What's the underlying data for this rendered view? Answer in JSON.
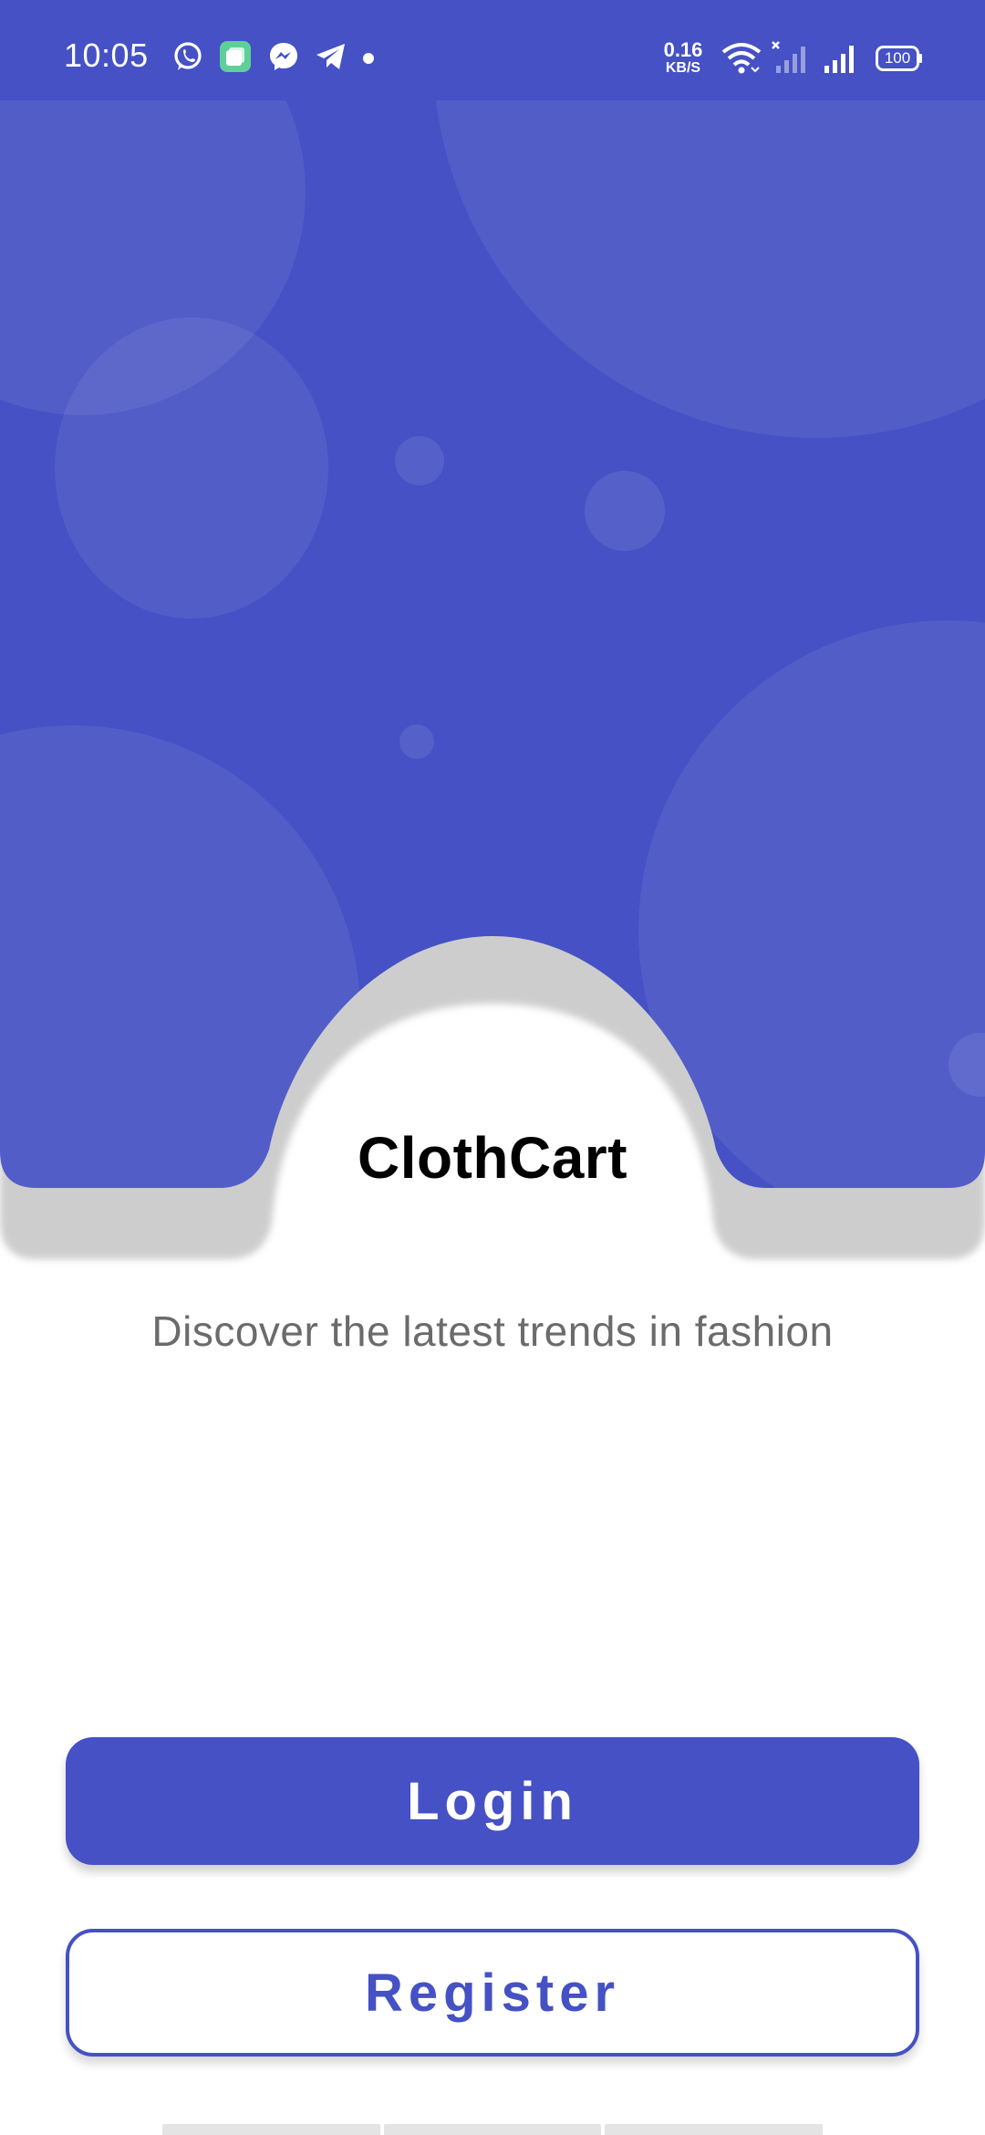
{
  "status_bar": {
    "time": "10:05",
    "net_speed_value": "0.16",
    "net_speed_unit": "KB/S",
    "battery": "100",
    "notification_icons": [
      "whatsapp-icon",
      "multitask-app-icon",
      "messenger-icon",
      "telegram-icon",
      "more-dot-icon"
    ],
    "system_icons": [
      "wifi-icon",
      "signal-no-sim-icon",
      "signal-icon",
      "battery-icon"
    ]
  },
  "app": {
    "name": "ClothCart",
    "tagline": "Discover the latest trends in fashion"
  },
  "actions": {
    "login_label": "Login",
    "register_label": "Register"
  },
  "colors": {
    "primary": "#4551c4",
    "shadow": "#cccccc",
    "background": "#ffffff",
    "tagline_text": "#6b6b6b"
  }
}
